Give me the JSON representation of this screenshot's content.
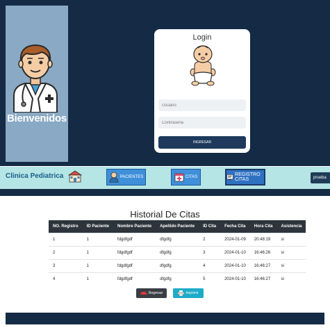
{
  "login": {
    "sidebar_text": "Bienvenidos",
    "title": "Login",
    "user_placeholder": "Usuario",
    "password_placeholder": "Contraseña",
    "submit_label": "INGRESAR"
  },
  "nav": {
    "brand": "Clinica Pediatrica",
    "pacientes_label": "PACIENTES",
    "citas_label": "CITAS",
    "registro_label": "REGISTRO CITAS",
    "user_label": "prueba"
  },
  "historial": {
    "title": "Historial De Citas",
    "columns": [
      "NO. Registro",
      "ID Paciente",
      "Nombre Paciente",
      "Apellido Paciente",
      "ID Cita",
      "Fecha Cita",
      "Hora Cita",
      "Asistencia"
    ],
    "rows": [
      [
        "1",
        "1",
        "fdgdfgdf",
        "dfgdfg",
        "2",
        "2024-01-09",
        "20:48:19",
        "si"
      ],
      [
        "2",
        "1",
        "fdgdfgdf",
        "dfgdfg",
        "3",
        "2024-01-10",
        "16:46:26",
        "si"
      ],
      [
        "3",
        "1",
        "fdgdfgdf",
        "dfgdfg",
        "4",
        "2024-01-10",
        "16:46:27",
        "si"
      ],
      [
        "4",
        "1",
        "fdgdfgdf",
        "dfgdfg",
        "5",
        "2024-01-10",
        "16:46:27",
        "si"
      ]
    ],
    "back_label": "Regresar",
    "print_label": "Imprimir"
  },
  "colors": {
    "navy": "#152a44",
    "sidebar_blue": "#8aa9c4",
    "navbar_teal": "#b5e5e5",
    "nav_button_blue": "#3f8fd9",
    "print_cyan": "#1dacc8"
  },
  "icons": [
    "doctor-avatar-icon",
    "baby-icon",
    "clinic-building-icon",
    "pacientes-icon",
    "citas-calendar-icon",
    "registro-icon",
    "back-car-icon",
    "printer-icon"
  ]
}
